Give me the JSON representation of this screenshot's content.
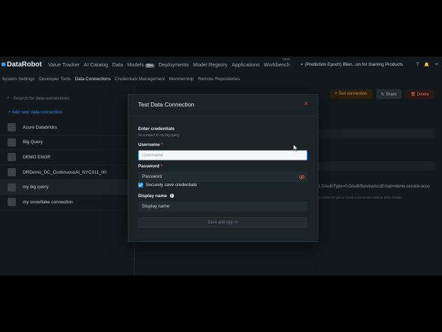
{
  "topnav": {
    "logo_text": "DataRobot",
    "items": [
      "Value Tracker",
      "AI Catalog",
      "Data",
      "Models",
      "Deployments",
      "Model Registry",
      "Applications",
      "Workbench"
    ],
    "models_badge": "99+",
    "workbench_tag": "NEW",
    "project": "(Prediction Epoch) Blen...on for Gaining Products",
    "help": "?",
    "bell": "🔔",
    "user": "≡"
  },
  "subnav": {
    "items": [
      "System Settings",
      "Developer Tools",
      "Data Connections",
      "Credentials Management",
      "Membership",
      "Remote Repositories"
    ],
    "active_index": 2
  },
  "sidebar": {
    "search_placeholder": "Search for data connections",
    "add_label": "+ Add new data connection",
    "items": [
      "Azure Databricks",
      "Big Query",
      "DEMO ENGR",
      "DRDemo_DC_ContinuousAI_NYC311_00",
      "my big query",
      "my snowflake connection"
    ],
    "selected_index": 4
  },
  "main": {
    "buttons": [
      "+ Test connection",
      "↻ Share",
      "🗑 Delete"
    ],
    "url_text": "/1;OAuthType=0;OAuthServiceAcctEmail=demo-service-acco",
    "hint_text": "possibility for you to create a connection without these breaks."
  },
  "modal": {
    "title": "Test Data Connection",
    "close": "×",
    "section_title": "Enter credentials",
    "section_sub": "To connect to my big query",
    "username_label": "Username",
    "username_placeholder": "Username",
    "password_label": "Password",
    "password_placeholder": "Password",
    "required_mark": "*",
    "save_creds_label": "Securely save credentials",
    "display_name_label": "Display name",
    "display_name_value": "Display name",
    "info_glyph": "i",
    "submit_label": "Save and sign in"
  },
  "colors": {
    "accent": "#3aa0ff",
    "danger": "#d9573f",
    "warning": "#c88a3d"
  }
}
